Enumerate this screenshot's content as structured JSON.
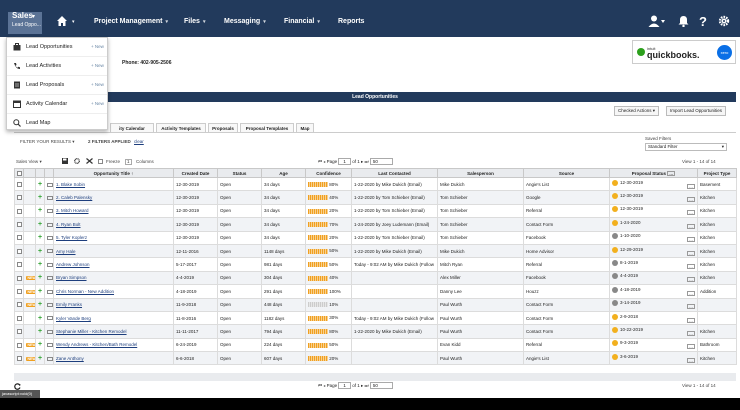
{
  "nav": {
    "sales": "Sales",
    "sales_sub": "Lead Oppo...",
    "items": [
      "Project Management",
      "Files",
      "Messaging",
      "Financial",
      "Reports"
    ]
  },
  "dropdown": [
    {
      "label": "Lead Opportunities",
      "new": "+ New"
    },
    {
      "label": "Lead Activities",
      "new": "+ New"
    },
    {
      "label": "Lead Proposals",
      "new": "+ New"
    },
    {
      "label": "Activity Calendar",
      "new": "+ New"
    },
    {
      "label": "Lead Map",
      "new": ""
    }
  ],
  "header": {
    "phone": "Phone: 402-905-2506",
    "qb_top": "intuit",
    "qb_brand": "quickbooks.",
    "xero": "xero"
  },
  "panel": {
    "title": "Lead Opportunities",
    "checked_actions": "Checked Actions",
    "import": "Import Lead Opportunities"
  },
  "tabs": [
    "ity Calendar",
    "Activity Templates",
    "Proposals",
    "Proposal Templates",
    "Map"
  ],
  "filter": {
    "label": "FILTER YOUR RESULTS",
    "applied": "2 FILTERS APPLIED",
    "clear": "clear",
    "saved_label": "Saved Filters",
    "saved_value": "Standard Filter"
  },
  "toolbar": {
    "view": "Sales View",
    "freeze": "Freeze",
    "freeze_num": "1",
    "columns": "Columns",
    "page_label": "Page",
    "page_value": "1",
    "of": "of 1",
    "per_page": "50",
    "count": "View 1 - 14 of 14"
  },
  "columns": [
    "Opportunity Title",
    "Created Date",
    "Status",
    "Age",
    "Confidence",
    "Last Contacted",
    "Salesperson",
    "Source",
    "Proposal Status",
    "Project Type"
  ],
  "rows": [
    {
      "new": "",
      "title": "1. Blake Sobin",
      "created": "12-30-2019",
      "status": "Open",
      "age": "34 days",
      "conf": "80%",
      "conf_level": "high",
      "last": "1-22-2020 by Mike Dukich (Email)",
      "sp": "Mike Dukich",
      "src": "Angie's List",
      "ps_color": "y",
      "ps": "12-30-2019",
      "pt": "Basement"
    },
    {
      "new": "",
      "title": "2. Caleb Palensky",
      "created": "12-30-2019",
      "status": "Open",
      "age": "34 days",
      "conf": "40%",
      "conf_level": "high",
      "last": "1-22-2020 by Tom Schieber (Email)",
      "sp": "Tom Schieber",
      "src": "Google",
      "ps_color": "y",
      "ps": "12-30-2019",
      "pt": "Kitchen"
    },
    {
      "new": "",
      "title": "3. Mitch Howard",
      "created": "12-30-2019",
      "status": "Open",
      "age": "34 days",
      "conf": "20%",
      "conf_level": "high",
      "last": "1-22-2020 by Tom Schieber (Email)",
      "sp": "Tom Schieber",
      "src": "Referral",
      "ps_color": "y",
      "ps": "12-30-2019",
      "pt": "Kitchen"
    },
    {
      "new": "",
      "title": "4. Ryan Bolt",
      "created": "12-30-2019",
      "status": "Open",
      "age": "34 days",
      "conf": "70%",
      "conf_level": "high",
      "last": "1-24-2020 by Joey Ludemann (Email)",
      "sp": "Tom Schieber",
      "src": "Contact Form",
      "ps_color": "y",
      "ps": "1-24-2020",
      "pt": "Kitchen"
    },
    {
      "new": "",
      "title": "5. Tyler Koplerz",
      "created": "12-30-2019",
      "status": "Open",
      "age": "34 days",
      "conf": "20%",
      "conf_level": "high",
      "last": "1-22-2020 by Tom Schieber (Email)",
      "sp": "Tom Schieber",
      "src": "Facebook",
      "ps_color": "g",
      "ps": "1-10-2020",
      "pt": "Kitchen"
    },
    {
      "new": "",
      "title": "Amy Hale",
      "created": "12-11-2016",
      "status": "Open",
      "age": "1148 days",
      "conf": "50%",
      "conf_level": "high",
      "last": "1-22-2020 by Mike Dukich (Email)",
      "sp": "Mike Dukich",
      "src": "Home Advisor",
      "ps_color": "y",
      "ps": "12-29-2019",
      "pt": "Kitchen"
    },
    {
      "new": "",
      "title": "Andrew Johnson",
      "created": "5-17-2017",
      "status": "Open",
      "age": "981 days",
      "conf": "50%",
      "conf_level": "high",
      "last": "Today - 9:02 AM by Mike Dukich (Follow",
      "sp": "Mitch Ryan",
      "src": "Referral",
      "ps_color": "g",
      "ps": "8-1-2019",
      "pt": "Kitchen"
    },
    {
      "new": "NEW",
      "title": "Bryan Simpson",
      "created": "4-4-2019",
      "status": "Open",
      "age": "304 days",
      "conf": "40%",
      "conf_level": "high",
      "last": "",
      "sp": "Alex Miller",
      "src": "Facebook",
      "ps_color": "g",
      "ps": "4-4-2019",
      "pt": "Kitchen"
    },
    {
      "new": "NEW",
      "title": "Chris Norman - New Addition",
      "created": "4-18-2019",
      "status": "Open",
      "age": "291 days",
      "conf": "100%",
      "conf_level": "high",
      "last": "",
      "sp": "Danny Lee",
      "src": "Houzz",
      "ps_color": "g",
      "ps": "4-18-2019",
      "pt": "Addition"
    },
    {
      "new": "NEW",
      "title": "Emily Franks",
      "created": "11-9-2018",
      "status": "Open",
      "age": "448 days",
      "conf": "10%",
      "conf_level": "low",
      "last": "",
      "sp": "Paul Wurth",
      "src": "Contact Form",
      "ps_color": "g",
      "ps": "3-14-2019",
      "pt": ""
    },
    {
      "new": "",
      "title": "Kyler Vande Berg",
      "created": "11-8-2016",
      "status": "Open",
      "age": "1182 days",
      "conf": "30%",
      "conf_level": "high",
      "last": "Today - 9:02 AM by Mike Dukich (Follow",
      "sp": "Paul Wurth",
      "src": "Contact Form",
      "ps_color": "y",
      "ps": "2-9-2018",
      "pt": ""
    },
    {
      "new": "",
      "title": "Stephanie Miller - Kitchen Remodel",
      "created": "11-11-2017",
      "status": "Open",
      "age": "794 days",
      "conf": "80%",
      "conf_level": "high",
      "last": "1-22-2020 by Mike Dukich (Email)",
      "sp": "Paul Wurth",
      "src": "Contact Form",
      "ps_color": "y",
      "ps": "10-22-2019",
      "pt": "Kitchen"
    },
    {
      "new": "NEW",
      "title": "Wendy Andrews - Kitchen/Bath Remodel",
      "created": "6-24-2019",
      "status": "Open",
      "age": "224 days",
      "conf": "50%",
      "conf_level": "high",
      "last": "",
      "sp": "Evan Kidd",
      "src": "Referral",
      "ps_color": "y",
      "ps": "9-3-2019",
      "pt": "Bathroom"
    },
    {
      "new": "NEW",
      "title": "Zane Anthony",
      "created": "6-6-2018",
      "status": "Open",
      "age": "607 days",
      "conf": "20%",
      "conf_level": "high",
      "last": "",
      "sp": "Paul Wurth",
      "src": "Angie's List",
      "ps_color": "y",
      "ps": "3-6-2019",
      "pt": "Kitchen"
    }
  ],
  "statusbar": "javascript:void(0)"
}
